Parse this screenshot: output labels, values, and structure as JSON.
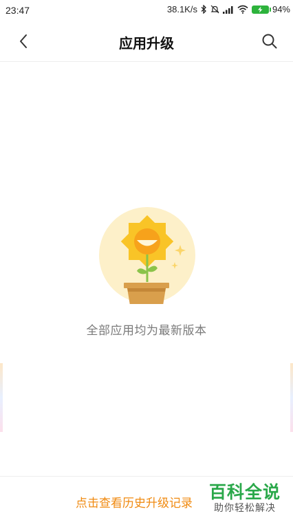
{
  "status_bar": {
    "time": "23:47",
    "network_speed": "38.1K/s",
    "battery": "94%",
    "icons": [
      "bluetooth-icon",
      "mute-icon",
      "signal-icon",
      "wifi-icon",
      "battery-charging-icon"
    ]
  },
  "header": {
    "title": "应用升级",
    "back_icon": "chevron-left-icon",
    "search_icon": "search-icon"
  },
  "empty_state": {
    "illustration": "sunflower-pot-icon",
    "message": "全部应用均为最新版本"
  },
  "footer": {
    "history_link": "点击查看历史升级记录"
  },
  "watermark": {
    "main": "百科全说",
    "sub": "助你轻松解决"
  },
  "colors": {
    "accent_orange": "#f08a10",
    "watermark_green": "#2aa84a",
    "illustration_bg": "#fdf0c9",
    "sunflower_yellow": "#f9c427",
    "pot_brown": "#d99f4c"
  }
}
